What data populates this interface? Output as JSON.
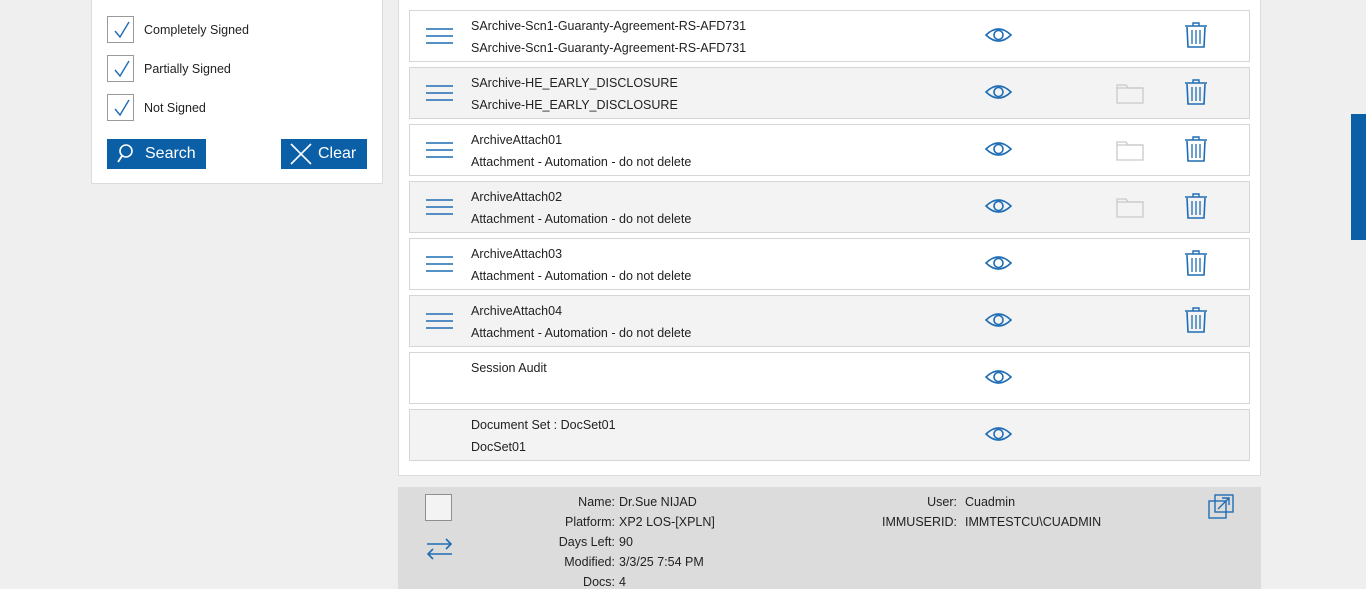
{
  "filters": {
    "checkboxes": [
      {
        "label": "Completely Signed",
        "checked": true
      },
      {
        "label": "Partially Signed",
        "checked": true
      },
      {
        "label": "Not Signed",
        "checked": true
      }
    ],
    "search_label": "Search",
    "clear_label": "Clear"
  },
  "documents": [
    {
      "title": "SArchive-Scn1-Guaranty-Agreement-RS-AFD731",
      "subtitle": "SArchive-Scn1-Guaranty-Agreement-RS-AFD731",
      "has_menu": true,
      "has_folder": false,
      "has_trash": true
    },
    {
      "title": "SArchive-HE_EARLY_DISCLOSURE",
      "subtitle": "SArchive-HE_EARLY_DISCLOSURE",
      "has_menu": true,
      "has_folder": true,
      "has_trash": true
    },
    {
      "title": "ArchiveAttach01",
      "subtitle": "Attachment - Automation - do not delete",
      "has_menu": true,
      "has_folder": true,
      "has_trash": true
    },
    {
      "title": "ArchiveAttach02",
      "subtitle": "Attachment - Automation - do not delete",
      "has_menu": true,
      "has_folder": true,
      "has_trash": true
    },
    {
      "title": "ArchiveAttach03",
      "subtitle": "Attachment - Automation - do not delete",
      "has_menu": true,
      "has_folder": false,
      "has_trash": true
    },
    {
      "title": "ArchiveAttach04",
      "subtitle": "Attachment - Automation - do not delete",
      "has_menu": true,
      "has_folder": false,
      "has_trash": true
    },
    {
      "title": "Session Audit",
      "subtitle": "",
      "has_menu": false,
      "has_folder": false,
      "has_trash": false
    },
    {
      "title": "Document Set : DocSet01",
      "subtitle": "DocSet01",
      "has_menu": false,
      "has_folder": false,
      "has_trash": false
    }
  ],
  "info": {
    "name_label": "Name:",
    "name_value": "Dr.Sue NIJAD",
    "platform_label": "Platform:",
    "platform_value": "XP2 LOS-[XPLN]",
    "days_left_label": "Days Left:",
    "days_left_value": "90",
    "modified_label": "Modified:",
    "modified_value": "3/3/25 7:54 PM",
    "docs_label": "Docs:",
    "docs_value": "4",
    "user_label": "User:",
    "user_value": "Cuadmin",
    "immuserid_label": "IMMUSERID:",
    "immuserid_value": "IMMTESTCU\\CUADMIN"
  },
  "colors": {
    "accent": "#0a5fa6",
    "icon": "#1f6db4",
    "folder": "#c9c9c9"
  }
}
